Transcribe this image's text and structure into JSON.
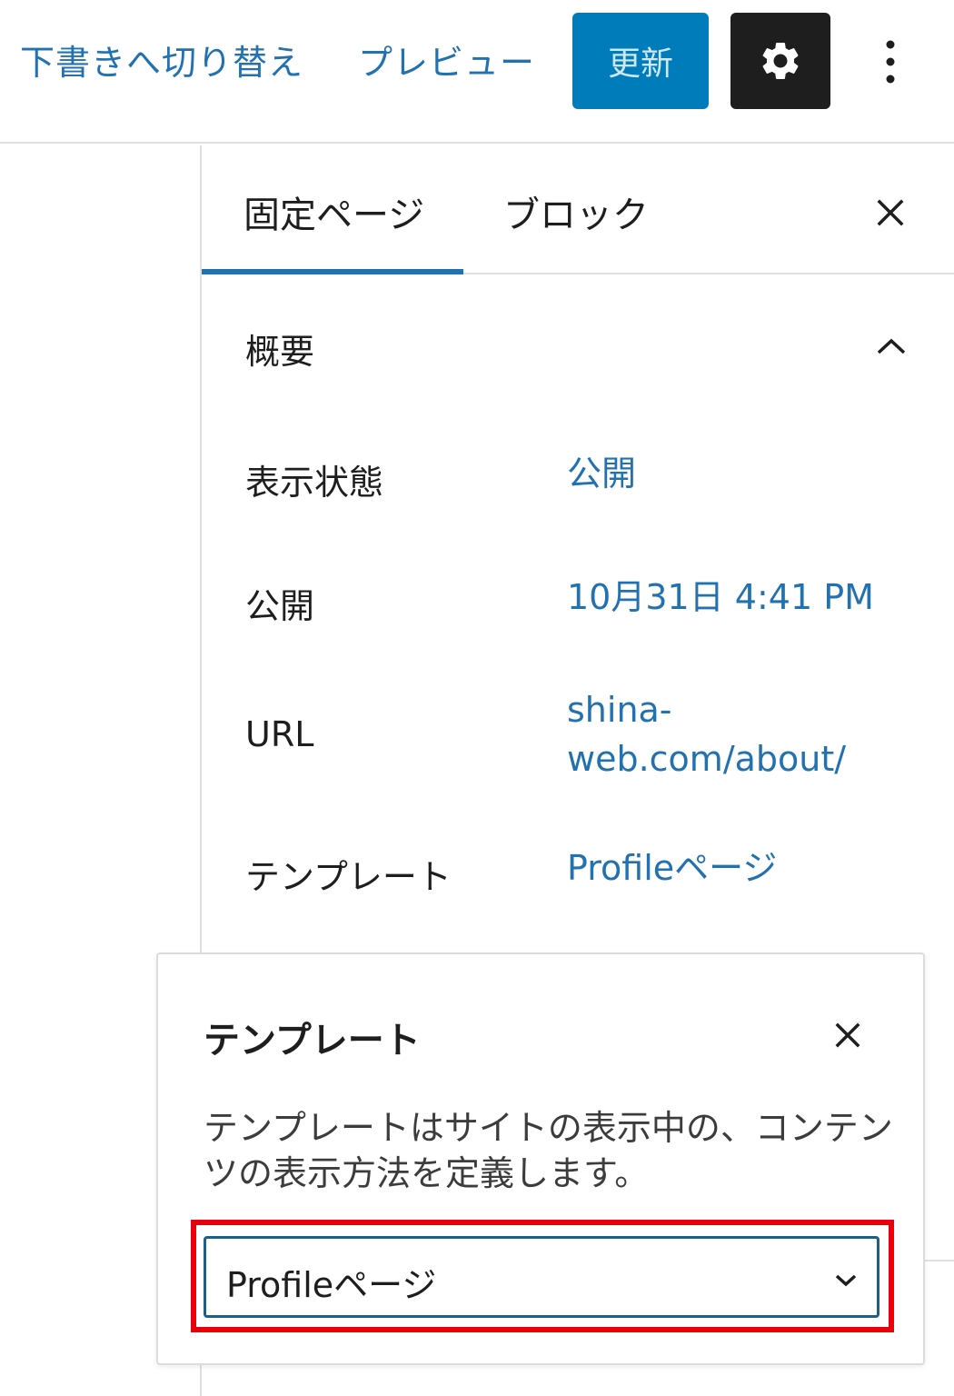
{
  "header": {
    "switch_to_draft": "下書きへ切り替え",
    "preview": "プレビュー",
    "update": "更新",
    "settings_icon": "gear-icon",
    "more_icon": "more-vertical-icon"
  },
  "sidebar": {
    "tabs": [
      {
        "label": "固定ページ",
        "active": true
      },
      {
        "label": "ブロック",
        "active": false
      }
    ],
    "close_icon": "close-icon",
    "panel": {
      "title": "概要",
      "toggle_icon": "chevron-up-icon",
      "rows": [
        {
          "label": "表示状態",
          "value": "公開"
        },
        {
          "label": "公開",
          "value": "10月31日 4:41 PM"
        },
        {
          "label": "URL",
          "value_line1": "shina-",
          "value_line2": "web.com/about/"
        },
        {
          "label": "テンプレート",
          "value": "Profileページ"
        }
      ]
    }
  },
  "popover": {
    "title": "テンプレート",
    "close_icon": "close-icon",
    "description": "テンプレートはサイトの表示中の、コンテンツの表示方法を定義します。",
    "select": {
      "value": "Profileページ",
      "chevron_icon": "chevron-down-icon"
    }
  },
  "colors": {
    "accent": "#2271b1",
    "primary_button": "#007cba",
    "dark_button": "#1e1e1e",
    "highlight": "#e8000b"
  }
}
